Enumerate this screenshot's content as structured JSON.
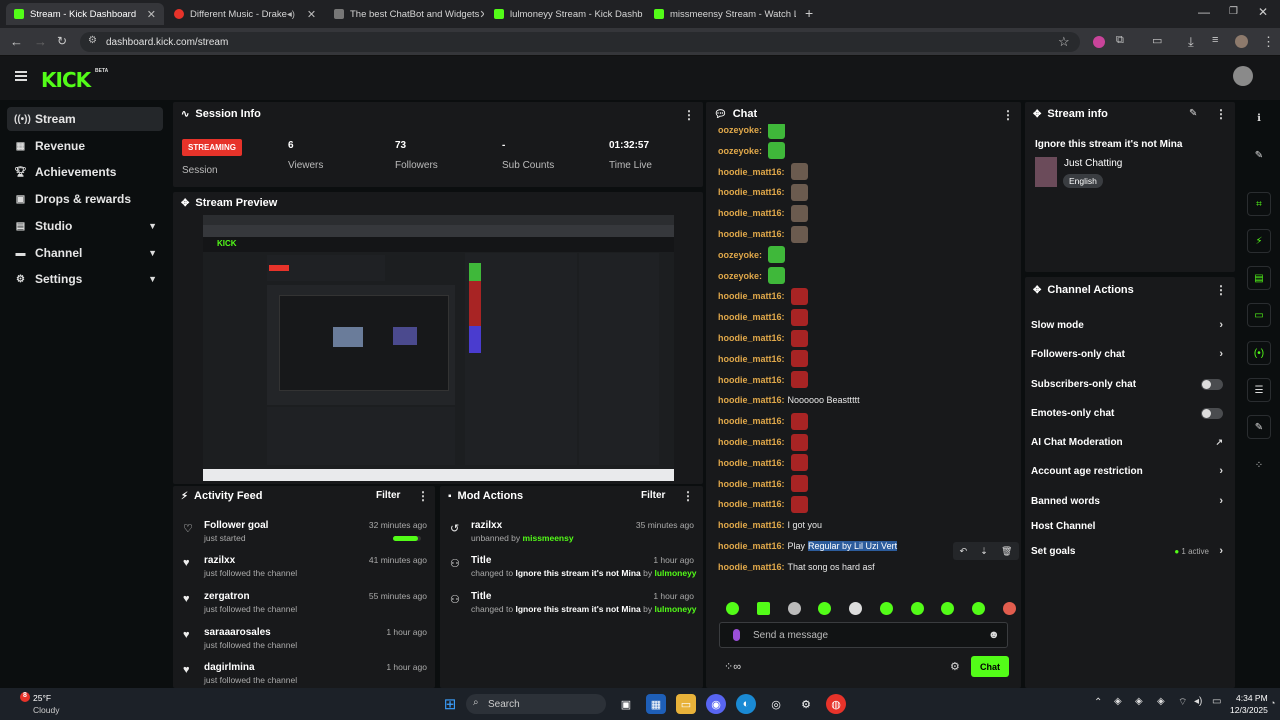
{
  "browser": {
    "tabs": [
      {
        "title": "Stream - Kick Dashboard",
        "favicon_color": "#53fc18"
      },
      {
        "title": "Different Music - Drake",
        "favicon_color": "#e7332a"
      },
      {
        "title": "The best ChatBot and Widgets",
        "favicon_color": "#888888"
      },
      {
        "title": "lulmoneyy Stream - Kick Dashb",
        "favicon_color": "#53fc18"
      },
      {
        "title": "missmeensy Stream - Watch Li",
        "favicon_color": "#53fc18"
      }
    ],
    "url": "dashboard.kick.com/stream"
  },
  "brand": {
    "logo": "KICK",
    "beta": "BETA",
    "accent": "#53fc18"
  },
  "sidebar": {
    "items": [
      {
        "label": "Stream",
        "icon": "stream-icon"
      },
      {
        "label": "Revenue",
        "icon": "revenue-icon"
      },
      {
        "label": "Achievements",
        "icon": "trophy-icon"
      },
      {
        "label": "Drops & rewards",
        "icon": "gift-icon"
      },
      {
        "label": "Studio",
        "icon": "studio-icon"
      },
      {
        "label": "Channel",
        "icon": "channel-icon"
      },
      {
        "label": "Settings",
        "icon": "gear-icon"
      }
    ]
  },
  "session": {
    "title": "Session Info",
    "badge": "STREAMING",
    "session_label": "Session",
    "viewers": "6",
    "viewers_label": "Viewers",
    "followers": "73",
    "followers_label": "Followers",
    "subs": "-",
    "subs_label": "Sub Counts",
    "time": "01:32:57",
    "time_label": "Time Live"
  },
  "preview": {
    "title": "Stream Preview"
  },
  "activity": {
    "title": "Activity Feed",
    "filter": "Filter",
    "goal": {
      "name": "Follower goal",
      "sub": "just started",
      "time": "32 minutes ago",
      "progress": 0.9
    },
    "items": [
      {
        "name": "razilxx",
        "sub": "just followed the channel",
        "time": "41 minutes ago"
      },
      {
        "name": "zergatron",
        "sub": "just followed the channel",
        "time": "55 minutes ago"
      },
      {
        "name": "saraaarosales",
        "sub": "just followed the channel",
        "time": "1 hour ago"
      },
      {
        "name": "dagirlmina",
        "sub": "just followed the channel",
        "time": "1 hour ago"
      }
    ]
  },
  "mod": {
    "title": "Mod Actions",
    "filter": "Filter",
    "unban": {
      "name": "razilxx",
      "action": "unbanned by",
      "by": "missmeensy",
      "time": "35 minutes ago"
    },
    "titles": [
      {
        "name": "Title",
        "pre": "changed to",
        "value": "Ignore this stream it's not Mina",
        "by_word": "by",
        "by": "lulmoneyy",
        "time": "1 hour ago"
      },
      {
        "name": "Title",
        "pre": "changed to",
        "value": "Ignore this stream it's not Mina",
        "by_word": "by",
        "by": "lulmoneyy",
        "time": "1 hour ago"
      }
    ]
  },
  "chat": {
    "title": "Chat",
    "messages": [
      {
        "user": "oozeyoke:",
        "emotes": [
          "green"
        ]
      },
      {
        "user": "oozeyoke:",
        "emotes": [
          "green"
        ]
      },
      {
        "user": "hoodie_matt16:",
        "emotes": [
          "face"
        ]
      },
      {
        "user": "hoodie_matt16:",
        "emotes": [
          "face"
        ]
      },
      {
        "user": "hoodie_matt16:",
        "emotes": [
          "face"
        ]
      },
      {
        "user": "hoodie_matt16:",
        "emotes": [
          "face"
        ]
      },
      {
        "user": "oozeyoke:",
        "emotes": [
          "green"
        ]
      },
      {
        "user": "oozeyoke:",
        "emotes": [
          "green"
        ]
      },
      {
        "user": "hoodie_matt16:",
        "emotes": [
          "red"
        ]
      },
      {
        "user": "hoodie_matt16:",
        "emotes": [
          "red"
        ]
      },
      {
        "user": "hoodie_matt16:",
        "emotes": [
          "red"
        ]
      },
      {
        "user": "hoodie_matt16:",
        "emotes": [
          "red"
        ]
      },
      {
        "user": "hoodie_matt16:",
        "emotes": [
          "red"
        ]
      },
      {
        "user": "hoodie_matt16:",
        "text": "Noooooo Beasttttt"
      },
      {
        "user": "hoodie_matt16:",
        "emotes": [
          "red"
        ]
      },
      {
        "user": "hoodie_matt16:",
        "emotes": [
          "red"
        ]
      },
      {
        "user": "hoodie_matt16:",
        "emotes": [
          "red"
        ]
      },
      {
        "user": "hoodie_matt16:",
        "emotes": [
          "red"
        ]
      },
      {
        "user": "hoodie_matt16:",
        "emotes": [
          "red"
        ]
      },
      {
        "user": "hoodie_matt16:",
        "text": "I got you"
      },
      {
        "user": "hoodie_matt16:",
        "text": "Play",
        "selected": "Regular by Lil Uzi Vert"
      },
      {
        "user": "hoodie_matt16:",
        "text": "That song os hard asf"
      }
    ],
    "input_placeholder": "Send a message",
    "send_label": "Chat"
  },
  "stream_info": {
    "title": "Stream info",
    "stream_title": "Ignore this stream it's not Mina",
    "category": "Just Chatting",
    "language": "English"
  },
  "channel_actions": {
    "title": "Channel Actions",
    "items": [
      {
        "label": "Slow mode",
        "control": "chevron"
      },
      {
        "label": "Followers-only chat",
        "control": "chevron"
      },
      {
        "label": "Subscribers-only chat",
        "control": "toggle"
      },
      {
        "label": "Emotes-only chat",
        "control": "toggle"
      },
      {
        "label": "AI Chat Moderation",
        "control": "external"
      },
      {
        "label": "Account age restriction",
        "control": "chevron"
      },
      {
        "label": "Banned words",
        "control": "chevron"
      },
      {
        "label": "Host Channel",
        "control": "none"
      },
      {
        "label": "Set goals",
        "control": "chevron",
        "status": "1 active"
      }
    ]
  },
  "taskbar": {
    "weather_temp": "25°F",
    "weather_desc": "Cloudy",
    "search": "Search",
    "time": "4:34 PM",
    "date": "12/3/2025"
  }
}
